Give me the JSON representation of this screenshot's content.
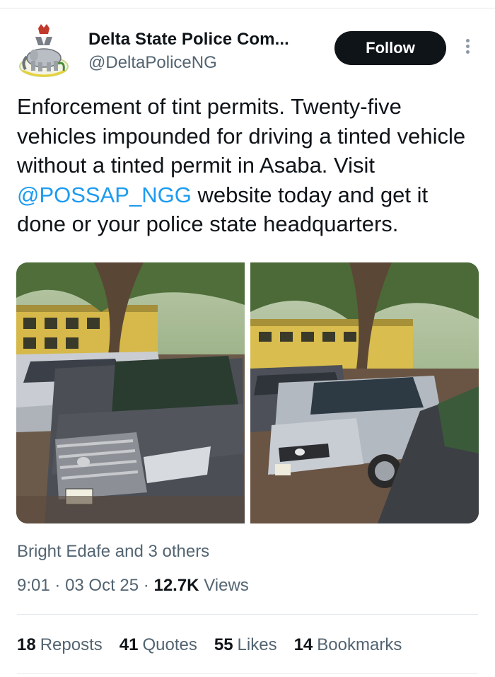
{
  "account": {
    "name": "Delta State Police Com...",
    "handle": "@DeltaPoliceNG",
    "follow_label": "Follow",
    "avatar_icon": "nigeria-coat-of-arms-elephant-logo"
  },
  "tweet": {
    "text_before": "Enforcement of tint permits. Twenty-five vehicles impounded for driving a tinted vehicle without a tinted permit in Asaba. Visit ",
    "mention": "@POSSAP_NGG",
    "text_after": " website today and get it done or your police state headquarters.",
    "photos": [
      {
        "icon": "photo-impounded-cars-toyota"
      },
      {
        "icon": "photo-impounded-cars-lexus",
        "plate": ""
      }
    ]
  },
  "engagement": {
    "liked_by": "Bright Edafe and 3 others",
    "time": "9:01",
    "date": "03 Oct 25",
    "separator": "·",
    "views_count": "12.7K",
    "views_label": "Views"
  },
  "stats": [
    {
      "count": "18",
      "label": "Reposts"
    },
    {
      "count": "41",
      "label": "Quotes"
    },
    {
      "count": "55",
      "label": "Likes"
    },
    {
      "count": "14",
      "label": "Bookmarks"
    }
  ],
  "colors": {
    "accent": "#1d9bf0",
    "text": "#0f1419",
    "secondary": "#536471",
    "follow_bg": "#0f1419"
  }
}
